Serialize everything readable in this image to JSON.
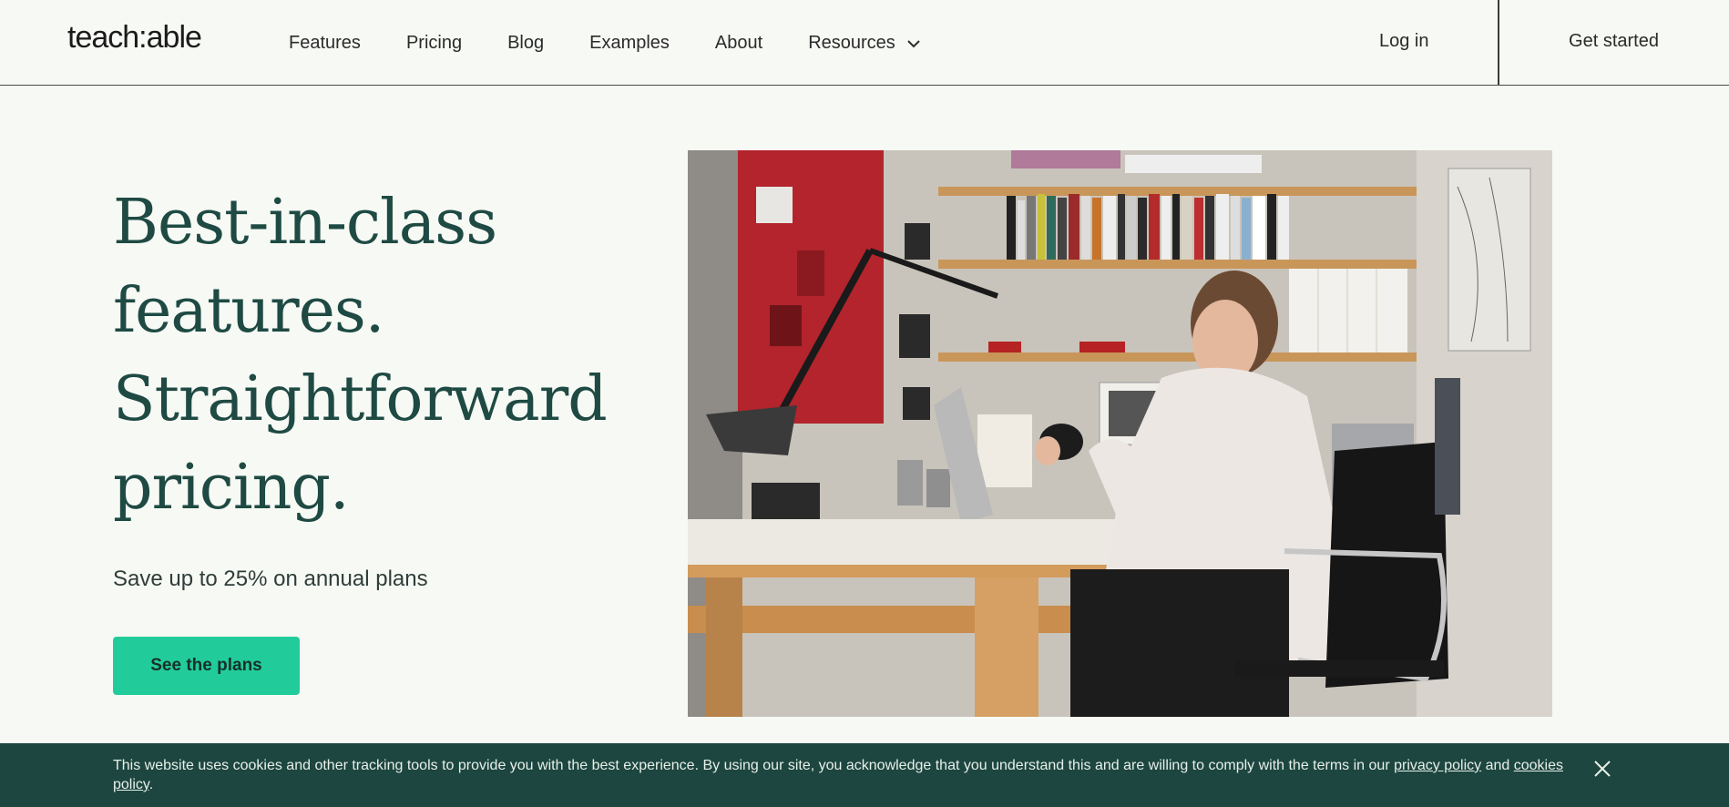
{
  "header": {
    "logo": "teach:able",
    "nav": [
      {
        "label": "Features"
      },
      {
        "label": "Pricing"
      },
      {
        "label": "Blog"
      },
      {
        "label": "Examples"
      },
      {
        "label": "About"
      },
      {
        "label": "Resources",
        "icon": "chevron-down-icon"
      }
    ],
    "login_label": "Log in",
    "get_started_label": "Get started"
  },
  "hero": {
    "title_lines": [
      "Best-in-class",
      "features.",
      "Straightforward",
      "pricing."
    ],
    "subtitle": "Save up to 25% on annual plans",
    "cta_label": "See the plans"
  },
  "cookie_banner": {
    "text_before": "This website uses cookies and other tracking tools to provide you with the best experience. By using our site, you acknowledge that you understand this and are willing to comply with the terms in our ",
    "privacy_link": "privacy policy",
    "text_middle": " and ",
    "cookies_link": "cookies policy",
    "text_after": ".",
    "close_icon": "close-icon"
  },
  "colors": {
    "background": "#f7f9f4",
    "heading": "#1e4a43",
    "cta": "#22cc9a",
    "banner": "#1d4640"
  }
}
